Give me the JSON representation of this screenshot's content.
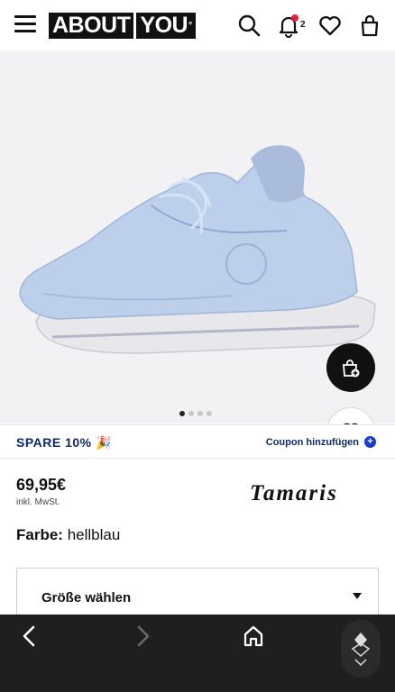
{
  "header": {
    "logo_left": "ABOUT",
    "logo_right": "YOU",
    "logo_mark": "°",
    "notification_count": "2",
    "icons": [
      "menu-icon",
      "search-icon",
      "bell-icon",
      "heart-icon",
      "shopping-bag-icon"
    ]
  },
  "gallery": {
    "image": "light blue knit sneaker",
    "image_count": 4,
    "active_index": 0,
    "colors": {
      "background": "#f2f2f4",
      "shoe": "#b7cbe8",
      "sole": "#e9e9ec"
    }
  },
  "promo": {
    "label": "SPARE 10% 🎉",
    "coupon_label": "Coupon hinzufügen",
    "coupon_icon": "+",
    "color": "#0e2a6b"
  },
  "product": {
    "price": "69,95€",
    "vat": "inkl. MwSt.",
    "brand": "Tamaris",
    "color_label": "Farbe:",
    "color_value": "hellblau"
  },
  "size": {
    "placeholder": "Größe wählen"
  },
  "bottom_nav": {
    "icons": [
      "back-arrow-icon",
      "forward-arrow-icon",
      "home-icon",
      "app-logo-icon"
    ],
    "forward_enabled": false
  }
}
